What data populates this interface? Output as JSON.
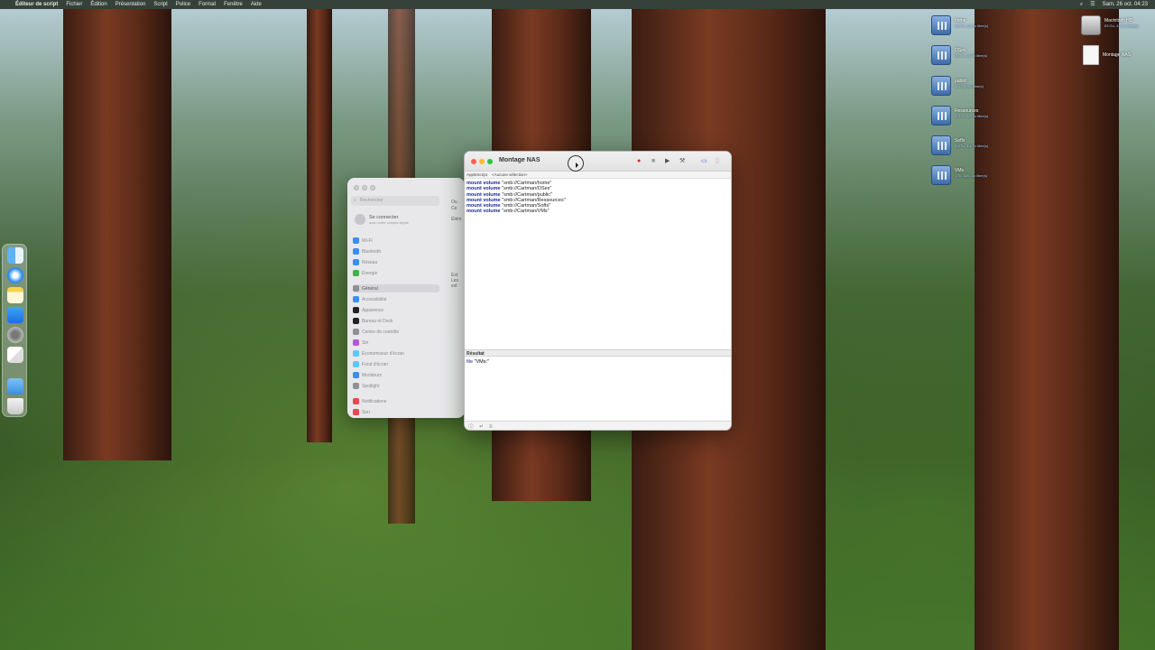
{
  "menubar": {
    "apple": "",
    "app_name": "Éditeur de script",
    "menus": [
      "Fichier",
      "Édition",
      "Présentation",
      "Script",
      "Police",
      "Format",
      "Fenêtre",
      "Aide"
    ],
    "datetime": "Sam. 26 oct. 04:23"
  },
  "desktop": {
    "icons": [
      {
        "name": "home",
        "sub": "6,6 To, 2,3 To libre(s)"
      },
      {
        "name": "OSes",
        "sub": "16 To, 1,9 To libre(s)"
      },
      {
        "name": "public",
        "sub": "107,33 Go libre(s)"
      },
      {
        "name": "Ressources",
        "sub": "3,3 To, 2,5 To libre(s)"
      },
      {
        "name": "Softs",
        "sub": "5,5 To, 3,4 To libre(s)"
      },
      {
        "name": "VMs",
        "sub": "1 To, 326 Go libre(s)"
      }
    ],
    "hd": {
      "name": "Macintosh HD",
      "sub": "63 Go, 41 Go libre(s)"
    },
    "doc": {
      "name": "Montage NAS"
    }
  },
  "settings": {
    "search_placeholder": "Rechercher",
    "account_title": "Se connecter",
    "account_sub": "avec votre compte Apple",
    "items": [
      {
        "label": "Wi-Fi",
        "color": "#3a8ef0"
      },
      {
        "label": "Bluetooth",
        "color": "#3a8ef0"
      },
      {
        "label": "Réseau",
        "color": "#3a8ef0"
      },
      {
        "label": "Énergie",
        "color": "#3cb34a"
      },
      {
        "label": "Général",
        "color": "#8e8e93"
      },
      {
        "label": "Accessibilité",
        "color": "#3a8ef0"
      },
      {
        "label": "Apparence",
        "color": "#222222"
      },
      {
        "label": "Bureau et Dock",
        "color": "#222222"
      },
      {
        "label": "Centre de contrôle",
        "color": "#8e8e93"
      },
      {
        "label": "Siri",
        "color": "#b05ad6"
      },
      {
        "label": "Économiseur d'écran",
        "color": "#5ac8fa"
      },
      {
        "label": "Fond d'écran",
        "color": "#5ac8fa"
      },
      {
        "label": "Moniteurs",
        "color": "#3a8ef0"
      },
      {
        "label": "Spotlight",
        "color": "#8e8e93"
      },
      {
        "label": "Notifications",
        "color": "#e5484d"
      },
      {
        "label": "Son",
        "color": "#e5484d"
      }
    ],
    "selected_index": 4,
    "pane_labels": [
      "Ou",
      "Ce",
      "Élém",
      "Ext",
      "Les",
      "ext"
    ]
  },
  "editor": {
    "title": "Montage NAS",
    "language": "AppleScript",
    "selector": "<Aucune sélection>",
    "lines": [
      {
        "kw": "mount volume",
        "str": "\"smb://Cartman/home\""
      },
      {
        "kw": "mount volume",
        "str": "\"smb://Cartman/OSes\""
      },
      {
        "kw": "mount volume",
        "str": "\"smb://Cartman/public\""
      },
      {
        "kw": "mount volume",
        "str": "\"smb://Cartman/Ressources\""
      },
      {
        "kw": "mount volume",
        "str": "\"smb://Cartman/Softs\""
      },
      {
        "kw": "mount volume",
        "str": "\"smb://Cartman/VMs\""
      }
    ],
    "result_header": "Résultat",
    "result_kw": "file",
    "result_val": "\"VMs:\""
  }
}
